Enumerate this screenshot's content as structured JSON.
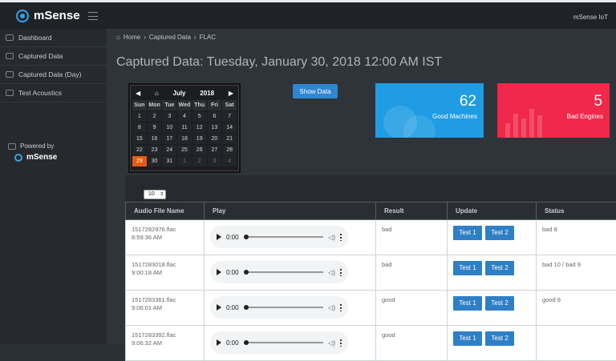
{
  "header": {
    "brand": "mSense",
    "user_menu": "mSense IoT"
  },
  "sidebar": {
    "items": [
      {
        "label": "Dashboard",
        "icon": "home-icon"
      },
      {
        "label": "Captured Data",
        "icon": "chart-icon"
      },
      {
        "label": "Captured Data (Day)",
        "icon": "car-icon"
      },
      {
        "label": "Test Acoustics",
        "icon": "pencil-icon"
      }
    ],
    "powered_by": "Powered by",
    "powered_brand": "mSense"
  },
  "breadcrumb": {
    "home": "Home",
    "section": "Captured Data",
    "current": "FLAC"
  },
  "page": {
    "title": "Captured Data: Tuesday, January 30, 2018 12:00 AM IST"
  },
  "calendar": {
    "month": "July",
    "year": "2018",
    "weekdays": [
      "Sun",
      "Mon",
      "Tue",
      "Wed",
      "Thu",
      "Fri",
      "Sat"
    ],
    "weeks": [
      [
        "1",
        "2",
        "3",
        "4",
        "5",
        "6",
        "7"
      ],
      [
        "8",
        "9",
        "10",
        "11",
        "12",
        "13",
        "14"
      ],
      [
        "15",
        "16",
        "17",
        "18",
        "19",
        "20",
        "21"
      ],
      [
        "22",
        "23",
        "24",
        "25",
        "26",
        "27",
        "28"
      ],
      [
        "29",
        "30",
        "31",
        "1",
        "2",
        "3",
        "4"
      ]
    ],
    "selected": "29"
  },
  "show_data_button": "Show Data",
  "tiles": {
    "good": {
      "value": "62",
      "label": "Good Machines",
      "color": "#1f9ce4"
    },
    "bad": {
      "value": "5",
      "label": "Bad Engines",
      "color": "#f0284a"
    }
  },
  "table": {
    "page_size": "10",
    "columns": [
      "Audio File Name",
      "Play",
      "Result",
      "Update",
      "Status"
    ],
    "rows": [
      {
        "file": "1517282976.flac",
        "time": "8:59:36 AM",
        "player_time": "0:00",
        "result": "bad",
        "test1": "Test 1",
        "test2": "Test 2",
        "status": "bad 8"
      },
      {
        "file": "1517283018.flac",
        "time": "9:00:18 AM",
        "player_time": "0:00",
        "result": "bad",
        "test1": "Test 1",
        "test2": "Test 2",
        "status": "bad 10 / bad 9"
      },
      {
        "file": "1517283361.flac",
        "time": "9:06:01 AM",
        "player_time": "0:00",
        "result": "good",
        "test1": "Test 1",
        "test2": "Test 2",
        "status": "good 9"
      },
      {
        "file": "1517283392.flac",
        "time": "9:06:32 AM",
        "player_time": "0:00",
        "result": "good",
        "test1": "Test 1",
        "test2": "Test 2",
        "status": ""
      }
    ]
  }
}
